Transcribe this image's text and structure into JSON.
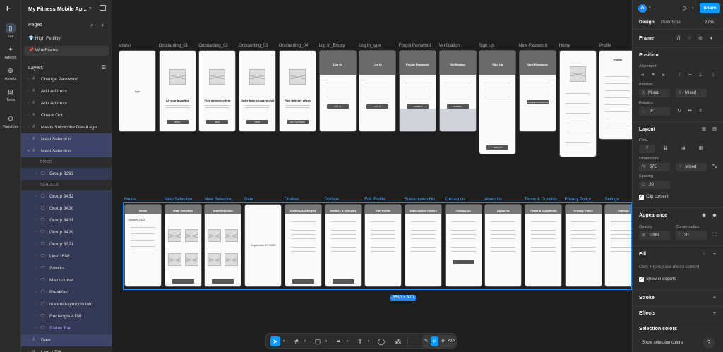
{
  "rail": {
    "logo": "F",
    "items": [
      {
        "label": "File",
        "icon": "file-icon",
        "glyph": "▯"
      },
      {
        "label": "Agents",
        "icon": "agents-icon",
        "glyph": "✦"
      },
      {
        "label": "Assets",
        "icon": "assets-icon",
        "glyph": "⊕"
      },
      {
        "label": "Tools",
        "icon": "tools-icon",
        "glyph": "⊞"
      },
      {
        "label": "Variables",
        "icon": "variables-icon",
        "glyph": "⊙"
      }
    ]
  },
  "project": {
    "name": "My Fitness Mobile Ap...",
    "chevron": "▾"
  },
  "pages": {
    "heading": "Pages",
    "search_icon": "⌕",
    "add_icon": "+",
    "items": [
      {
        "label": "💎 High Fedility"
      },
      {
        "label": "📌 WireFrame"
      }
    ]
  },
  "layers": {
    "heading": "Layers",
    "items": [
      {
        "label": "Change Password",
        "indent": 0
      },
      {
        "label": "Add Address",
        "indent": 0
      },
      {
        "label": "Add Address",
        "indent": 0
      },
      {
        "label": "Check Out",
        "indent": 0
      },
      {
        "label": "Meals Subscribe Detail age",
        "indent": 0
      },
      {
        "label": "Meal Selection",
        "indent": 0,
        "state": "sel"
      },
      {
        "label": "Meal Selection",
        "indent": 0,
        "state": "sel",
        "open": true
      },
      {
        "label": "FIXED",
        "caption": true
      },
      {
        "label": "Group 8283",
        "indent": 1,
        "state": "sub"
      },
      {
        "label": "SCROLLS",
        "caption": true
      },
      {
        "label": "Group 8432",
        "indent": 1,
        "state": "sub"
      },
      {
        "label": "Group 8430",
        "indent": 1,
        "state": "sub"
      },
      {
        "label": "Group 8431",
        "indent": 1,
        "state": "sub"
      },
      {
        "label": "Group 8429",
        "indent": 1,
        "state": "sub"
      },
      {
        "label": "Group 8321",
        "indent": 1,
        "state": "sub"
      },
      {
        "label": "Line 1698",
        "indent": 1,
        "state": "sub"
      },
      {
        "label": "Snacks",
        "indent": 1,
        "state": "sub"
      },
      {
        "label": "Maincourse",
        "indent": 1,
        "state": "sub"
      },
      {
        "label": "Breakfast",
        "indent": 1,
        "state": "sub"
      },
      {
        "label": "material-symbols:info",
        "indent": 1,
        "state": "sub"
      },
      {
        "label": "Rectangle 4188",
        "indent": 1,
        "state": "sub"
      },
      {
        "label": "Status Bar",
        "indent": 1,
        "state": "sub",
        "purple": true
      },
      {
        "label": "Date",
        "indent": 0,
        "state": "sel"
      },
      {
        "label": "Line 1706",
        "indent": 0
      }
    ]
  },
  "canvas": {
    "row1": [
      {
        "label": "splash",
        "title": "",
        "body": "logo"
      },
      {
        "label": "Onboarding_01",
        "title": "All your favorites",
        "btn": "NEXT"
      },
      {
        "label": "Onboarding_02",
        "title": "Free delivery offers",
        "btn": "NEXT"
      },
      {
        "label": "Onboarding_03",
        "title": "Order from choosen chef",
        "btn": "NEXT"
      },
      {
        "label": "Onboarding_04",
        "title": "Free delivery offers",
        "btn": "GET STARTED"
      },
      {
        "label": "Log In_Empty",
        "title": "Log In",
        "btn": "LOG IN"
      },
      {
        "label": "Log In_type",
        "title": "Log In",
        "btn": "LOG IN"
      },
      {
        "label": "Forgot Password",
        "title": "Forgot Password",
        "btn": "SUBMIT"
      },
      {
        "label": "Verification",
        "title": "Verification",
        "btn": "SUBMIT"
      },
      {
        "label": "Sign Up",
        "title": "Sign Up",
        "btn": "SIGN UP"
      },
      {
        "label": "New Password",
        "title": "New Password",
        "btn": "CHANGE PASSWORD"
      },
      {
        "label": "Home",
        "title": ""
      },
      {
        "label": "Profile",
        "title": "Profile"
      }
    ],
    "row2": [
      {
        "label": "Meals",
        "title": "Meals"
      },
      {
        "label": "Meal Selection",
        "title": "Meal Selection"
      },
      {
        "label": "Meal Selection",
        "title": "Meal Selection"
      },
      {
        "label": "Date",
        "title": ""
      },
      {
        "label": "Dislikes",
        "title": "Dislikes & Allergies"
      },
      {
        "label": "Dislikes",
        "title": "Dislikes & Allergies"
      },
      {
        "label": "Edit Profile",
        "title": "Edit Profile"
      },
      {
        "label": "Subscription His...",
        "title": "Subscription History"
      },
      {
        "label": "Contact Us",
        "title": "Contact Us"
      },
      {
        "label": "About Us",
        "title": "About Us"
      },
      {
        "label": "Terms & Conditio...",
        "title": "Terms & Conditions"
      },
      {
        "label": "Privacy Policy",
        "title": "Privacy Policy"
      },
      {
        "label": "Setings",
        "title": "Settings"
      }
    ],
    "calendar_month": "October 2022",
    "date_picker": "September  17  2021",
    "selection_size": "5510 × 870"
  },
  "toolbar": {
    "tools": [
      {
        "name": "move-tool",
        "glyph": "➤"
      },
      {
        "name": "frame-tool",
        "glyph": "#"
      },
      {
        "name": "shape-tool",
        "glyph": "▢"
      },
      {
        "name": "pen-tool",
        "glyph": "✒"
      },
      {
        "name": "text-tool",
        "glyph": "T"
      },
      {
        "name": "comment-tool",
        "glyph": "◯"
      },
      {
        "name": "actions-tool",
        "glyph": "⁂"
      },
      {
        "name": "draw-mode",
        "glyph": "✎"
      },
      {
        "name": "design-mode",
        "glyph": "⊟"
      },
      {
        "name": "prototype-mode",
        "glyph": "◈"
      },
      {
        "name": "dev-mode",
        "glyph": "</>"
      }
    ]
  },
  "right": {
    "avatar": "A",
    "share": "Share",
    "tabs": [
      "Design",
      "Prototype"
    ],
    "zoom": "27%",
    "frame_label": "Frame",
    "position": {
      "heading": "Position",
      "alignment": "Alignment",
      "position_label": "Position",
      "x_key": "X",
      "x_val": "Mixed",
      "y_key": "Y",
      "y_val": "Mixed",
      "rotation_label": "Rotation",
      "rotation_val": "0°"
    },
    "layout": {
      "heading": "Layout",
      "flow": "Flow",
      "dimensions": "Dimensions",
      "w_key": "W",
      "w_val": "375",
      "h_key": "H",
      "h_val": "Mixed",
      "spacing": "Spacing",
      "spacing_val": "20",
      "clip": "Clip content"
    },
    "appearance": {
      "heading": "Appearance",
      "opacity": "Opacity",
      "opacity_val": "100%",
      "radius": "Corner radius",
      "radius_val": "30"
    },
    "fill": {
      "heading": "Fill",
      "hint": "Click + to replace mixed content",
      "show": "Show in exports"
    },
    "stroke": "Stroke",
    "effects": "Effects",
    "selection_colors": "Selection colors",
    "show_selection_colors": "Show selection colors",
    "help": "?"
  }
}
